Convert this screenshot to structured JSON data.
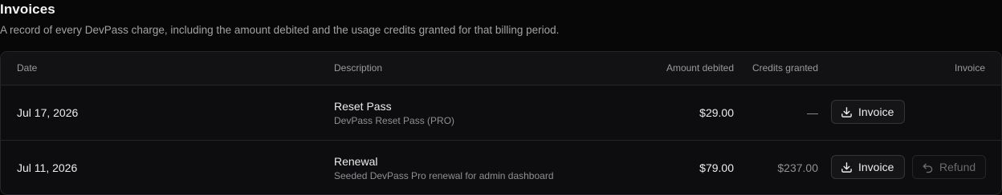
{
  "section": {
    "title": "Invoices",
    "subtitle": "A record of every DevPass charge, including the amount debited and the usage credits granted for that billing period."
  },
  "table": {
    "columns": {
      "date": "Date",
      "description": "Description",
      "amount": "Amount debited",
      "credits": "Credits granted",
      "invoice": "Invoice"
    },
    "rows": [
      {
        "date": "Jul 17, 2026",
        "title": "Reset Pass",
        "detail": "DevPass Reset Pass (PRO)",
        "amount": "$29.00",
        "credits": "—",
        "invoice_label": "Invoice"
      },
      {
        "date": "Jul 11, 2026",
        "title": "Renewal",
        "detail": "Seeded DevPass Pro renewal for admin dashboard",
        "amount": "$79.00",
        "credits": "$237.00",
        "invoice_label": "Invoice",
        "refund_label": "Refund"
      }
    ]
  },
  "icons": {
    "download": "download-icon",
    "refund": "undo-icon"
  }
}
